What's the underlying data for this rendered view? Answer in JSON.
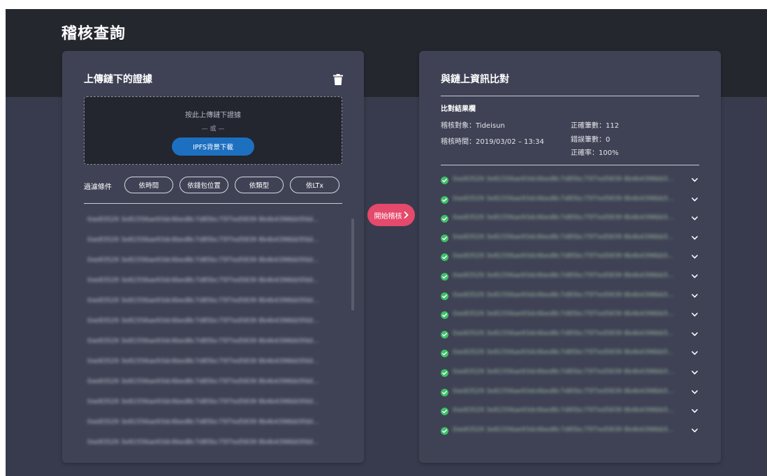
{
  "page": {
    "title": "稽核查詢"
  },
  "left_panel": {
    "title": "上傳鏈下的證據",
    "trash_icon": "trash-icon",
    "dropzone": {
      "hint": "按此上傳鏈下證據",
      "or_text": "— 或 —",
      "button_label": "IPFS背景下載"
    },
    "filter": {
      "label": "過濾條件",
      "options": [
        "依時間",
        "依錢包位置",
        "依類型",
        "依LTx"
      ]
    },
    "items": [
      "0xe83529 3e81556ae93dc6bed8c7d85bc75f7ed5839 8b4b4396bb5fdd...",
      "0xe83529 3e81556ae93dc6bed8c7d85bc75f7ed5839 8b4b4396bb5fdd...",
      "0xe83529 3e81556ae93dc6bed8c7d85bc75f7ed5839 8b4b4396bb5fdd...",
      "0xe83529 3e81556ae93dc6bed8c7d85bc75f7ed5839 8b4b4396bb5fdd...",
      "0xe83529 3e81556ae93dc6bed8c7d85bc75f7ed5839 8b4b4396bb5fdd...",
      "0xe83529 3e81556ae93dc6bed8c7d85bc75f7ed5839 8b4b4396bb5fdd...",
      "0xe83529 3e81556ae93dc6bed8c7d85bc75f7ed5839 8b4b4396bb5fdd...",
      "0xe83529 3e81556ae93dc6bed8c7d85bc75f7ed5839 8b4b4396bb5fdd...",
      "0xe83529 3e81556ae93dc6bed8c7d85bc75f7ed5839 8b4b4396bb5fdd...",
      "0xe83529 3e81556ae93dc6bed8c7d85bc75f7ed5839 8b4b4396bb5fdd...",
      "0xe83529 3e81556ae93dc6bed8c7d85bc75f7ed5839 8b4b4396bb5fdd...",
      "0xe83529 3e81556ae93dc6bed8c7d85bc75f7ed5839 8b4b4396bb5fdd..."
    ]
  },
  "start_button": {
    "label": "開始稽核",
    "icon": "chevron-right-icon",
    "color": "#e5496b"
  },
  "right_panel": {
    "title": "與鏈上資訊比對",
    "result_heading": "比對結果欄",
    "audit_target": "稽核對象：Tideisun",
    "audit_time": "稽核時間：2019/03/02 – 13:34",
    "correct_count": "正確筆數：112",
    "error_count": "錯誤筆數：0",
    "accuracy": "正確率：100%",
    "check_color": "#3fbf6a",
    "results": [
      "0xe83529 3e81556ae93dc6bed8c7d85bc75f7ed5839 8b4b4396bb5...",
      "0xe83529 3e81556ae93dc6bed8c7d85bc75f7ed5839 8b4b4396bb5...",
      "0xe83529 3e81556ae93dc6bed8c7d85bc75f7ed5839 8b4b4396bb5...",
      "0xe83529 3e81556ae93dc6bed8c7d85bc75f7ed5839 8b4b4396bb5...",
      "0xe83529 3e81556ae93dc6bed8c7d85bc75f7ed5839 8b4b4396bb5...",
      "0xe83529 3e81556ae93dc6bed8c7d85bc75f7ed5839 8b4b4396bb5...",
      "0xe83529 3e81556ae93dc6bed8c7d85bc75f7ed5839 8b4b4396bb5...",
      "0xe83529 3e81556ae93dc6bed8c7d85bc75f7ed5839 8b4b4396bb5...",
      "0xe83529 3e81556ae93dc6bed8c7d85bc75f7ed5839 8b4b4396bb5...",
      "0xe83529 3e81556ae93dc6bed8c7d85bc75f7ed5839 8b4b4396bb5...",
      "0xe83529 3e81556ae93dc6bed8c7d85bc75f7ed5839 8b4b4396bb5...",
      "0xe83529 3e81556ae93dc6bed8c7d85bc75f7ed5839 8b4b4396bb5...",
      "0xe83529 3e81556ae93dc6bed8c7d85bc75f7ed5839 8b4b4396bb5...",
      "0xe83529 3e81556ae93dc6bed8c7d85bc75f7ed5839 8b4b4396bb5..."
    ]
  }
}
